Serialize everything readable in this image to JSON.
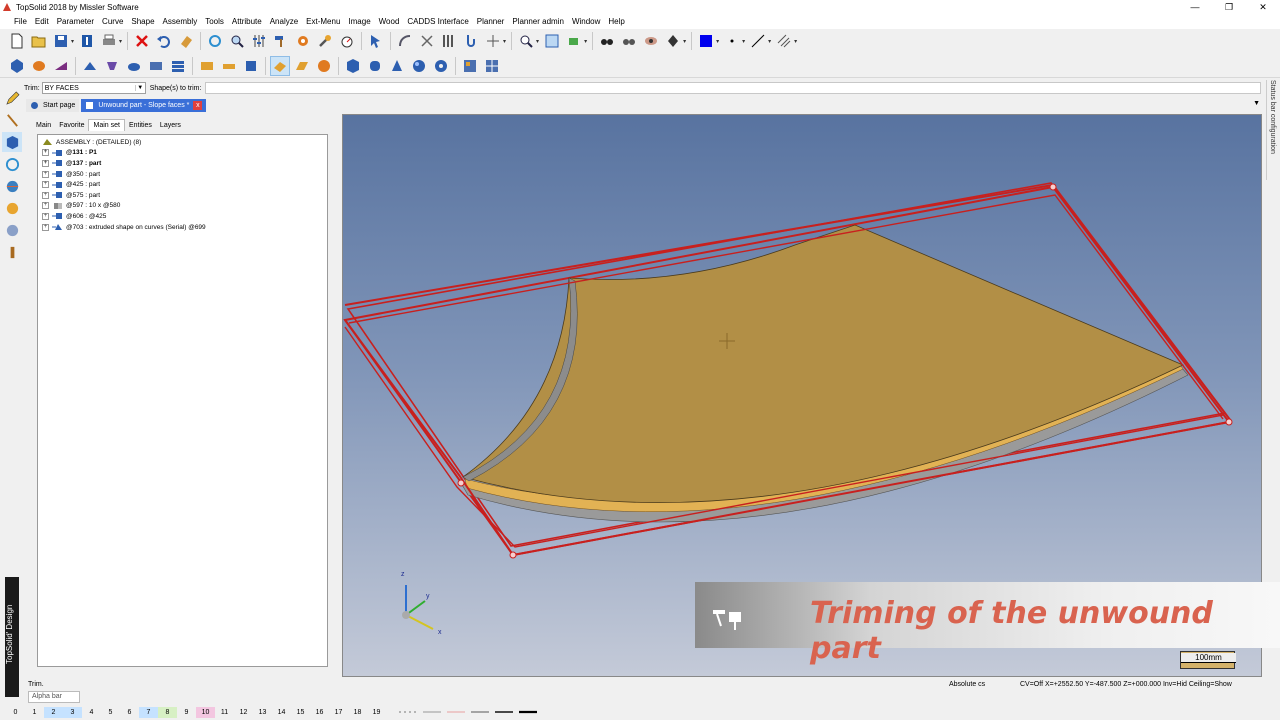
{
  "window": {
    "title": "TopSolid 2018 by Missler Software",
    "controls": [
      "—",
      "❐",
      "✕"
    ]
  },
  "menu": [
    "File",
    "Edit",
    "Parameter",
    "Curve",
    "Shape",
    "Assembly",
    "Tools",
    "Attribute",
    "Analyze",
    "Ext-Menu",
    "Image",
    "Wood",
    "CADDS Interface",
    "Planner",
    "Planner admin",
    "Window",
    "Help"
  ],
  "trimbar": {
    "trim_label": "Trim:",
    "trim_value": "BY FACES",
    "shapes_label": "Shape(s) to trim:"
  },
  "status_config": "Status bar configuration",
  "doc_tabs": {
    "start": "Start page",
    "active": "Unwound part - Slope faces *",
    "close": "x"
  },
  "panel_tabs": [
    "Main",
    "Favorite",
    "Main set",
    "Entities",
    "Layers"
  ],
  "tree": [
    {
      "label": "ASSEMBLY : (DETAILED) (8)",
      "bold": false
    },
    {
      "label": "@131 : P1",
      "bold": true
    },
    {
      "label": "@137 : part",
      "bold": true
    },
    {
      "label": "@350 : part",
      "bold": false
    },
    {
      "label": "@425 : part",
      "bold": false
    },
    {
      "label": "@575 : part",
      "bold": false
    },
    {
      "label": "@597 : 10 x @580",
      "bold": false
    },
    {
      "label": "@606 : @425",
      "bold": false
    },
    {
      "label": "@703 : extruded shape on curves (Serial) @699",
      "bold": false
    }
  ],
  "viewport": {
    "axis_x": "x",
    "axis_y": "y",
    "axis_z": "z",
    "scale_label": "100mm",
    "colors": {
      "part": "#b28f46",
      "trim_box": "#c8201e",
      "edge": "#8c8c8c"
    }
  },
  "caption": {
    "text": "Triming of the unwound part"
  },
  "brand": "TopSolid' Design",
  "status": {
    "message": "Trim.",
    "cs": "Absolute cs",
    "coords": "CV=Off  X=+2552.50  Y=-487.500  Z=+000.000  Inv=Hid  Ceiling=Show",
    "alpha_bar": "Alpha bar"
  },
  "layers": [
    "0",
    "1",
    "2",
    "3",
    "4",
    "5",
    "6",
    "7",
    "8",
    "9",
    "10",
    "11",
    "12",
    "13",
    "14",
    "15",
    "16",
    "17",
    "18",
    "19"
  ]
}
